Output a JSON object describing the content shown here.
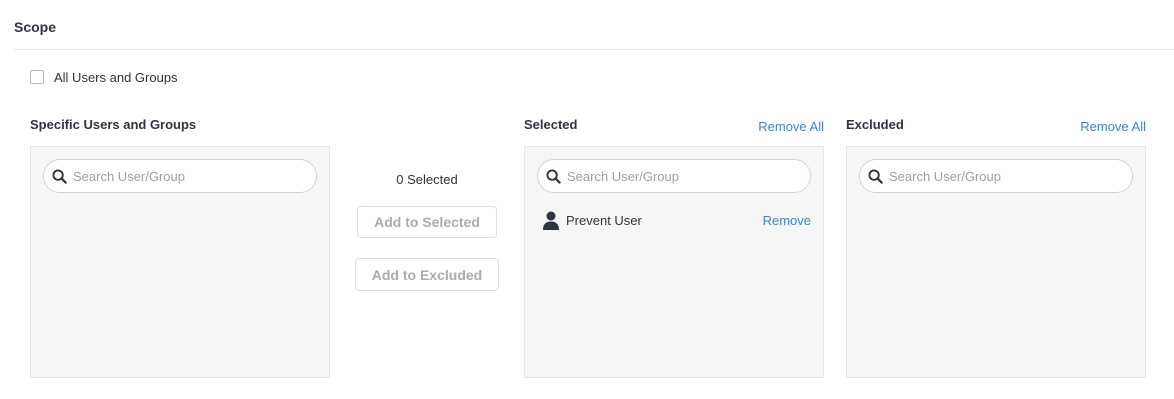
{
  "scope": {
    "title": "Scope",
    "all_users_label": "All Users and Groups"
  },
  "specific": {
    "title": "Specific Users and Groups",
    "search_placeholder": "Search User/Group"
  },
  "middle": {
    "count_label": "0 Selected",
    "add_selected_label": "Add to Selected",
    "add_excluded_label": "Add to Excluded"
  },
  "selected": {
    "title": "Selected",
    "remove_all_label": "Remove All",
    "search_placeholder": "Search User/Group",
    "items": [
      {
        "name": "Prevent User",
        "remove_label": "Remove",
        "icon": "user-icon"
      }
    ]
  },
  "excluded": {
    "title": "Excluded",
    "remove_all_label": "Remove All",
    "search_placeholder": "Search User/Group"
  },
  "colors": {
    "link": "#3a86d4",
    "panel_bg": "#f6f6f6",
    "text": "#2b3642"
  }
}
